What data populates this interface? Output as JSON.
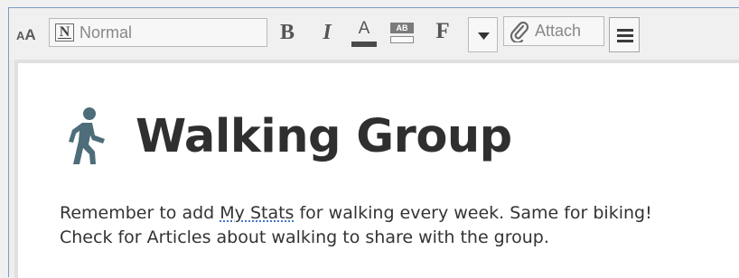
{
  "toolbar": {
    "font_size_small": "A",
    "font_size_big": "A",
    "style_icon": "N",
    "style_value": "Normal",
    "bold_label": "B",
    "italic_label": "I",
    "font_color_label": "A",
    "highlight_label": "AB",
    "font_label": "F",
    "attach_label": "Attach",
    "icons": [
      "text-size-icon",
      "paragraph-style-icon",
      "bold-icon",
      "italic-icon",
      "font-color-icon",
      "highlight-icon",
      "font-icon",
      "chevron-down-icon",
      "attach-icon",
      "menu-icon"
    ],
    "colors": {
      "font_color_bar": "#4a4a4a",
      "heading_icon": "#4e6d7a",
      "link_underline": "#3a6fc4"
    }
  },
  "editor": {
    "heading": {
      "icon": "walking-person-icon",
      "title": "Walking Group"
    },
    "body": {
      "line1_prefix": "Remember to add ",
      "line1_link": "My Stats",
      "line1_suffix": " for walking every week. Same for biking!",
      "line2": "Check for Articles about walking to share with the group."
    }
  }
}
